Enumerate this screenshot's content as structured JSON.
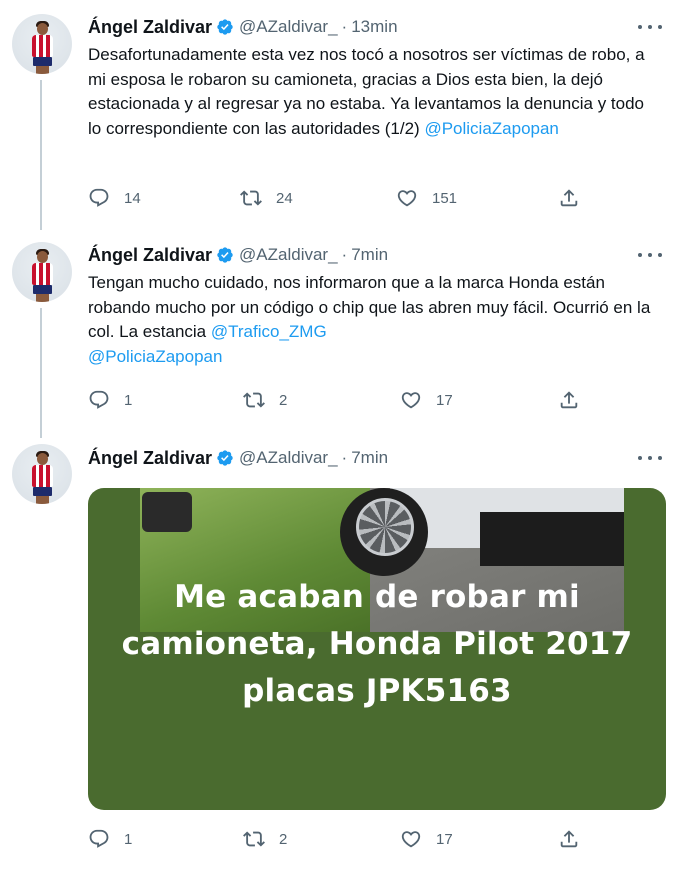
{
  "tweets": [
    {
      "author_name": "Ángel Zaldivar",
      "handle": "@AZaldivar_",
      "separator": "·",
      "time": "13min",
      "text_parts": [
        {
          "text": "Desafortunadamente esta vez nos tocó a nosotros ser víctimas de robo, a mi esposa le robaron su camioneta, gracias a Dios esta bien, la dejó estacionada y al regresar ya no estaba. Ya levantamos la denuncia y todo lo correspondiente con las autoridades (1/2)  "
        },
        {
          "text": "@PoliciaZapopan",
          "mention": true
        }
      ],
      "replies": "14",
      "retweets": "24",
      "likes": "151"
    },
    {
      "author_name": "Ángel Zaldivar",
      "handle": "@AZaldivar_",
      "separator": "·",
      "time": "7min",
      "text_parts": [
        {
          "text": "Tengan mucho cuidado, nos informaron que a la marca Honda están robando mucho por un código o chip que las abren muy fácil. Ocurrió en la col. La estancia  "
        },
        {
          "text": "@Trafico_ZMG",
          "mention": true
        },
        {
          "text": " "
        },
        {
          "text": "@PoliciaZapopan",
          "mention": true
        }
      ],
      "replies": "1",
      "retweets": "2",
      "likes": "17"
    },
    {
      "author_name": "Ángel Zaldivar",
      "handle": "@AZaldivar_",
      "separator": "·",
      "time": "7min",
      "media_caption": "Me acaban de robar mi camioneta, Honda Pilot 2017 placas JPK5163",
      "replies": "1",
      "retweets": "2",
      "likes": "17"
    }
  ],
  "icons": {
    "reply": "reply-icon",
    "retweet": "retweet-icon",
    "like": "heart-icon",
    "share": "share-icon",
    "verified": "verified-badge-icon",
    "more": "more-options-icon"
  },
  "colors": {
    "accent": "#1d9bf0",
    "text": "#0f1419",
    "muted": "#536471",
    "thread_line": "#c4cfd6",
    "media_bg": "#4a6b2f"
  }
}
